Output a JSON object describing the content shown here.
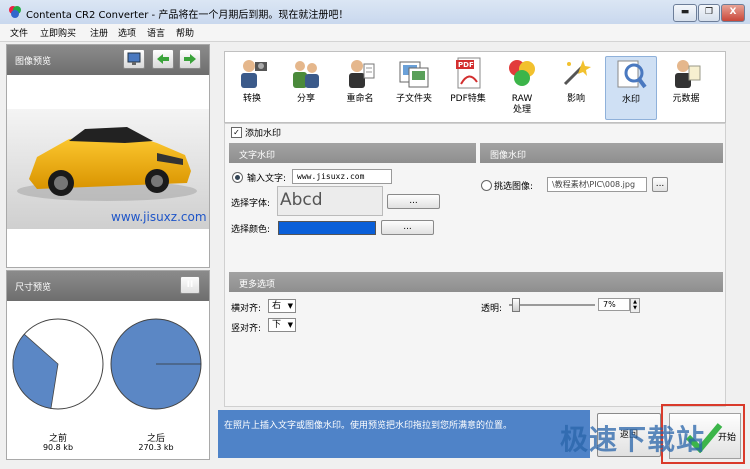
{
  "window": {
    "title": "Contenta CR2 Converter - 产品将在一个月期后到期。现在就注册吧！",
    "controls": [
      "▬",
      "❐",
      "X"
    ]
  },
  "menu": [
    "文件",
    "立即购买",
    "注册",
    "选项",
    "语言",
    "帮助"
  ],
  "preview": {
    "title": "图像预览",
    "image_watermark": "www.jisuxz.com"
  },
  "size_preview": {
    "title": "尺寸预览",
    "pause_label": "II",
    "before_label": "之前",
    "before_size": "90.8 kb",
    "after_label": "之后",
    "after_size": "270.3 kb",
    "before_fraction": 0.34,
    "after_fraction": 1.0
  },
  "toolbar": [
    {
      "label": "转换",
      "icon": "convert-icon"
    },
    {
      "label": "分享",
      "icon": "share-icon"
    },
    {
      "label": "重命名",
      "icon": "rename-icon"
    },
    {
      "label": "子文件夹",
      "icon": "subfolder-icon"
    },
    {
      "label": "PDF特集",
      "icon": "pdf-icon"
    },
    {
      "label": "RAW\n处理",
      "icon": "raw-icon"
    },
    {
      "label": "影响",
      "icon": "effects-icon"
    },
    {
      "label": "水印",
      "icon": "watermark-icon"
    },
    {
      "label": "元数据",
      "icon": "metadata-icon"
    }
  ],
  "watermark": {
    "add_label": "添加水印",
    "text_section": "文字水印",
    "image_section": "图像水印",
    "input_text_label": "输入文字:",
    "input_text_value": "www.jisuxz.com",
    "font_label": "选择字体:",
    "font_preview": "Abcd",
    "color_label": "选择颜色:",
    "color_value": "#0a5fd8",
    "browse_label": "...",
    "pick_image_label": "挑选图像:",
    "image_path": "\\教程素材\\PIC\\008.jpg"
  },
  "more": {
    "title": "更多选项",
    "h_align_label": "横对齐:",
    "h_align_value": "右",
    "v_align_label": "竖对齐:",
    "v_align_value": "下",
    "opacity_label": "透明:",
    "opacity_value": "7%",
    "opacity_fraction": 0.07
  },
  "hint": "在照片上插入文字或图像水印。使用预览把水印拖拉到您所满意的位置。",
  "buttons": {
    "back_label": "返回",
    "run_label": "开始"
  },
  "site_watermark": "极速下载站"
}
